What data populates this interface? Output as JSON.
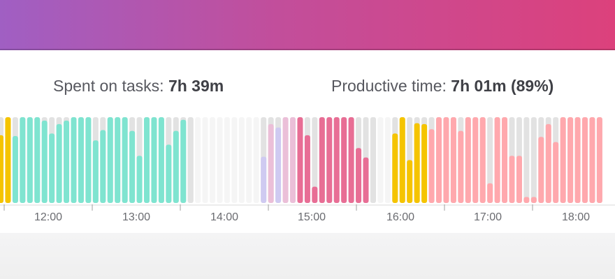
{
  "summary": {
    "spent_label": "Spent on tasks:",
    "spent_value": "7h 39m",
    "productive_label": "Productive time:",
    "productive_value": "7h 01m (89%)"
  },
  "timeline": {
    "ticks": [
      "12:00",
      "13:00",
      "14:00",
      "15:00",
      "16:00",
      "17:00",
      "18:00"
    ],
    "category_colors": {
      "orange": "#f5c400",
      "teal": "#7fe4d0",
      "empty": "#e2e2e2",
      "faint": "#f5f5f5",
      "lavender": "#cfcaf1",
      "lightpink": "#ebbfd8",
      "pink": "#e86e95",
      "salmon": "#ffa8ad"
    },
    "bars": [
      {
        "c": "orange",
        "v": 0.79
      },
      {
        "c": "orange",
        "v": 1.0
      },
      {
        "c": "teal",
        "v": 0.78
      },
      {
        "c": "teal",
        "v": 1.0
      },
      {
        "c": "teal",
        "v": 1.0
      },
      {
        "c": "teal",
        "v": 1.0
      },
      {
        "c": "teal",
        "v": 0.96
      },
      {
        "c": "teal",
        "v": 0.81
      },
      {
        "c": "teal",
        "v": 0.92
      },
      {
        "c": "teal",
        "v": 0.96
      },
      {
        "c": "teal",
        "v": 1.0
      },
      {
        "c": "teal",
        "v": 1.0
      },
      {
        "c": "teal",
        "v": 1.0
      },
      {
        "c": "teal",
        "v": 0.73
      },
      {
        "c": "teal",
        "v": 0.85
      },
      {
        "c": "teal",
        "v": 1.0
      },
      {
        "c": "teal",
        "v": 1.0
      },
      {
        "c": "teal",
        "v": 1.0
      },
      {
        "c": "teal",
        "v": 0.84
      },
      {
        "c": "teal",
        "v": 0.55
      },
      {
        "c": "teal",
        "v": 1.0
      },
      {
        "c": "teal",
        "v": 1.0
      },
      {
        "c": "teal",
        "v": 1.0
      },
      {
        "c": "teal",
        "v": 0.68
      },
      {
        "c": "teal",
        "v": 0.84
      },
      {
        "c": "teal",
        "v": 0.97
      },
      {
        "c": "empty",
        "v": 1.0
      },
      {
        "c": "faint",
        "v": 1.0
      },
      {
        "c": "faint",
        "v": 1.0
      },
      {
        "c": "faint",
        "v": 1.0
      },
      {
        "c": "faint",
        "v": 1.0
      },
      {
        "c": "faint",
        "v": 1.0
      },
      {
        "c": "faint",
        "v": 1.0
      },
      {
        "c": "faint",
        "v": 1.0
      },
      {
        "c": "faint",
        "v": 1.0
      },
      {
        "c": "faint",
        "v": 1.0
      },
      {
        "c": "lavender",
        "v": 0.54
      },
      {
        "c": "lightpink",
        "v": 0.92
      },
      {
        "c": "lavender",
        "v": 0.88
      },
      {
        "c": "lightpink",
        "v": 1.0
      },
      {
        "c": "lightpink",
        "v": 1.0
      },
      {
        "c": "pink",
        "v": 1.0
      },
      {
        "c": "pink",
        "v": 0.79
      },
      {
        "c": "pink",
        "v": 0.19
      },
      {
        "c": "pink",
        "v": 1.0
      },
      {
        "c": "pink",
        "v": 1.0
      },
      {
        "c": "pink",
        "v": 1.0
      },
      {
        "c": "pink",
        "v": 1.0
      },
      {
        "c": "pink",
        "v": 1.0
      },
      {
        "c": "pink",
        "v": 0.64
      },
      {
        "c": "pink",
        "v": 0.53
      },
      {
        "c": "empty",
        "v": 1.0
      },
      {
        "c": "faint",
        "v": 1.0
      },
      {
        "c": "faint",
        "v": 1.0
      },
      {
        "c": "orange",
        "v": 0.81
      },
      {
        "c": "orange",
        "v": 1.0
      },
      {
        "c": "orange",
        "v": 0.5
      },
      {
        "c": "orange",
        "v": 0.93
      },
      {
        "c": "orange",
        "v": 0.92
      },
      {
        "c": "salmon",
        "v": 0.86
      },
      {
        "c": "salmon",
        "v": 1.0
      },
      {
        "c": "salmon",
        "v": 1.0
      },
      {
        "c": "salmon",
        "v": 1.0
      },
      {
        "c": "salmon",
        "v": 0.84
      },
      {
        "c": "salmon",
        "v": 1.0
      },
      {
        "c": "salmon",
        "v": 1.0
      },
      {
        "c": "salmon",
        "v": 1.0
      },
      {
        "c": "salmon",
        "v": 0.23
      },
      {
        "c": "salmon",
        "v": 1.0
      },
      {
        "c": "salmon",
        "v": 1.0
      },
      {
        "c": "salmon",
        "v": 0.55
      },
      {
        "c": "salmon",
        "v": 0.55
      },
      {
        "c": "salmon",
        "v": 0.07
      },
      {
        "c": "salmon",
        "v": 0.07
      },
      {
        "c": "salmon",
        "v": 0.77
      },
      {
        "c": "salmon",
        "v": 0.92
      },
      {
        "c": "salmon",
        "v": 0.71
      },
      {
        "c": "salmon",
        "v": 1.0
      },
      {
        "c": "salmon",
        "v": 1.0
      },
      {
        "c": "salmon",
        "v": 1.0
      },
      {
        "c": "salmon",
        "v": 1.0
      },
      {
        "c": "salmon",
        "v": 1.0
      },
      {
        "c": "salmon",
        "v": 1.0
      }
    ]
  }
}
